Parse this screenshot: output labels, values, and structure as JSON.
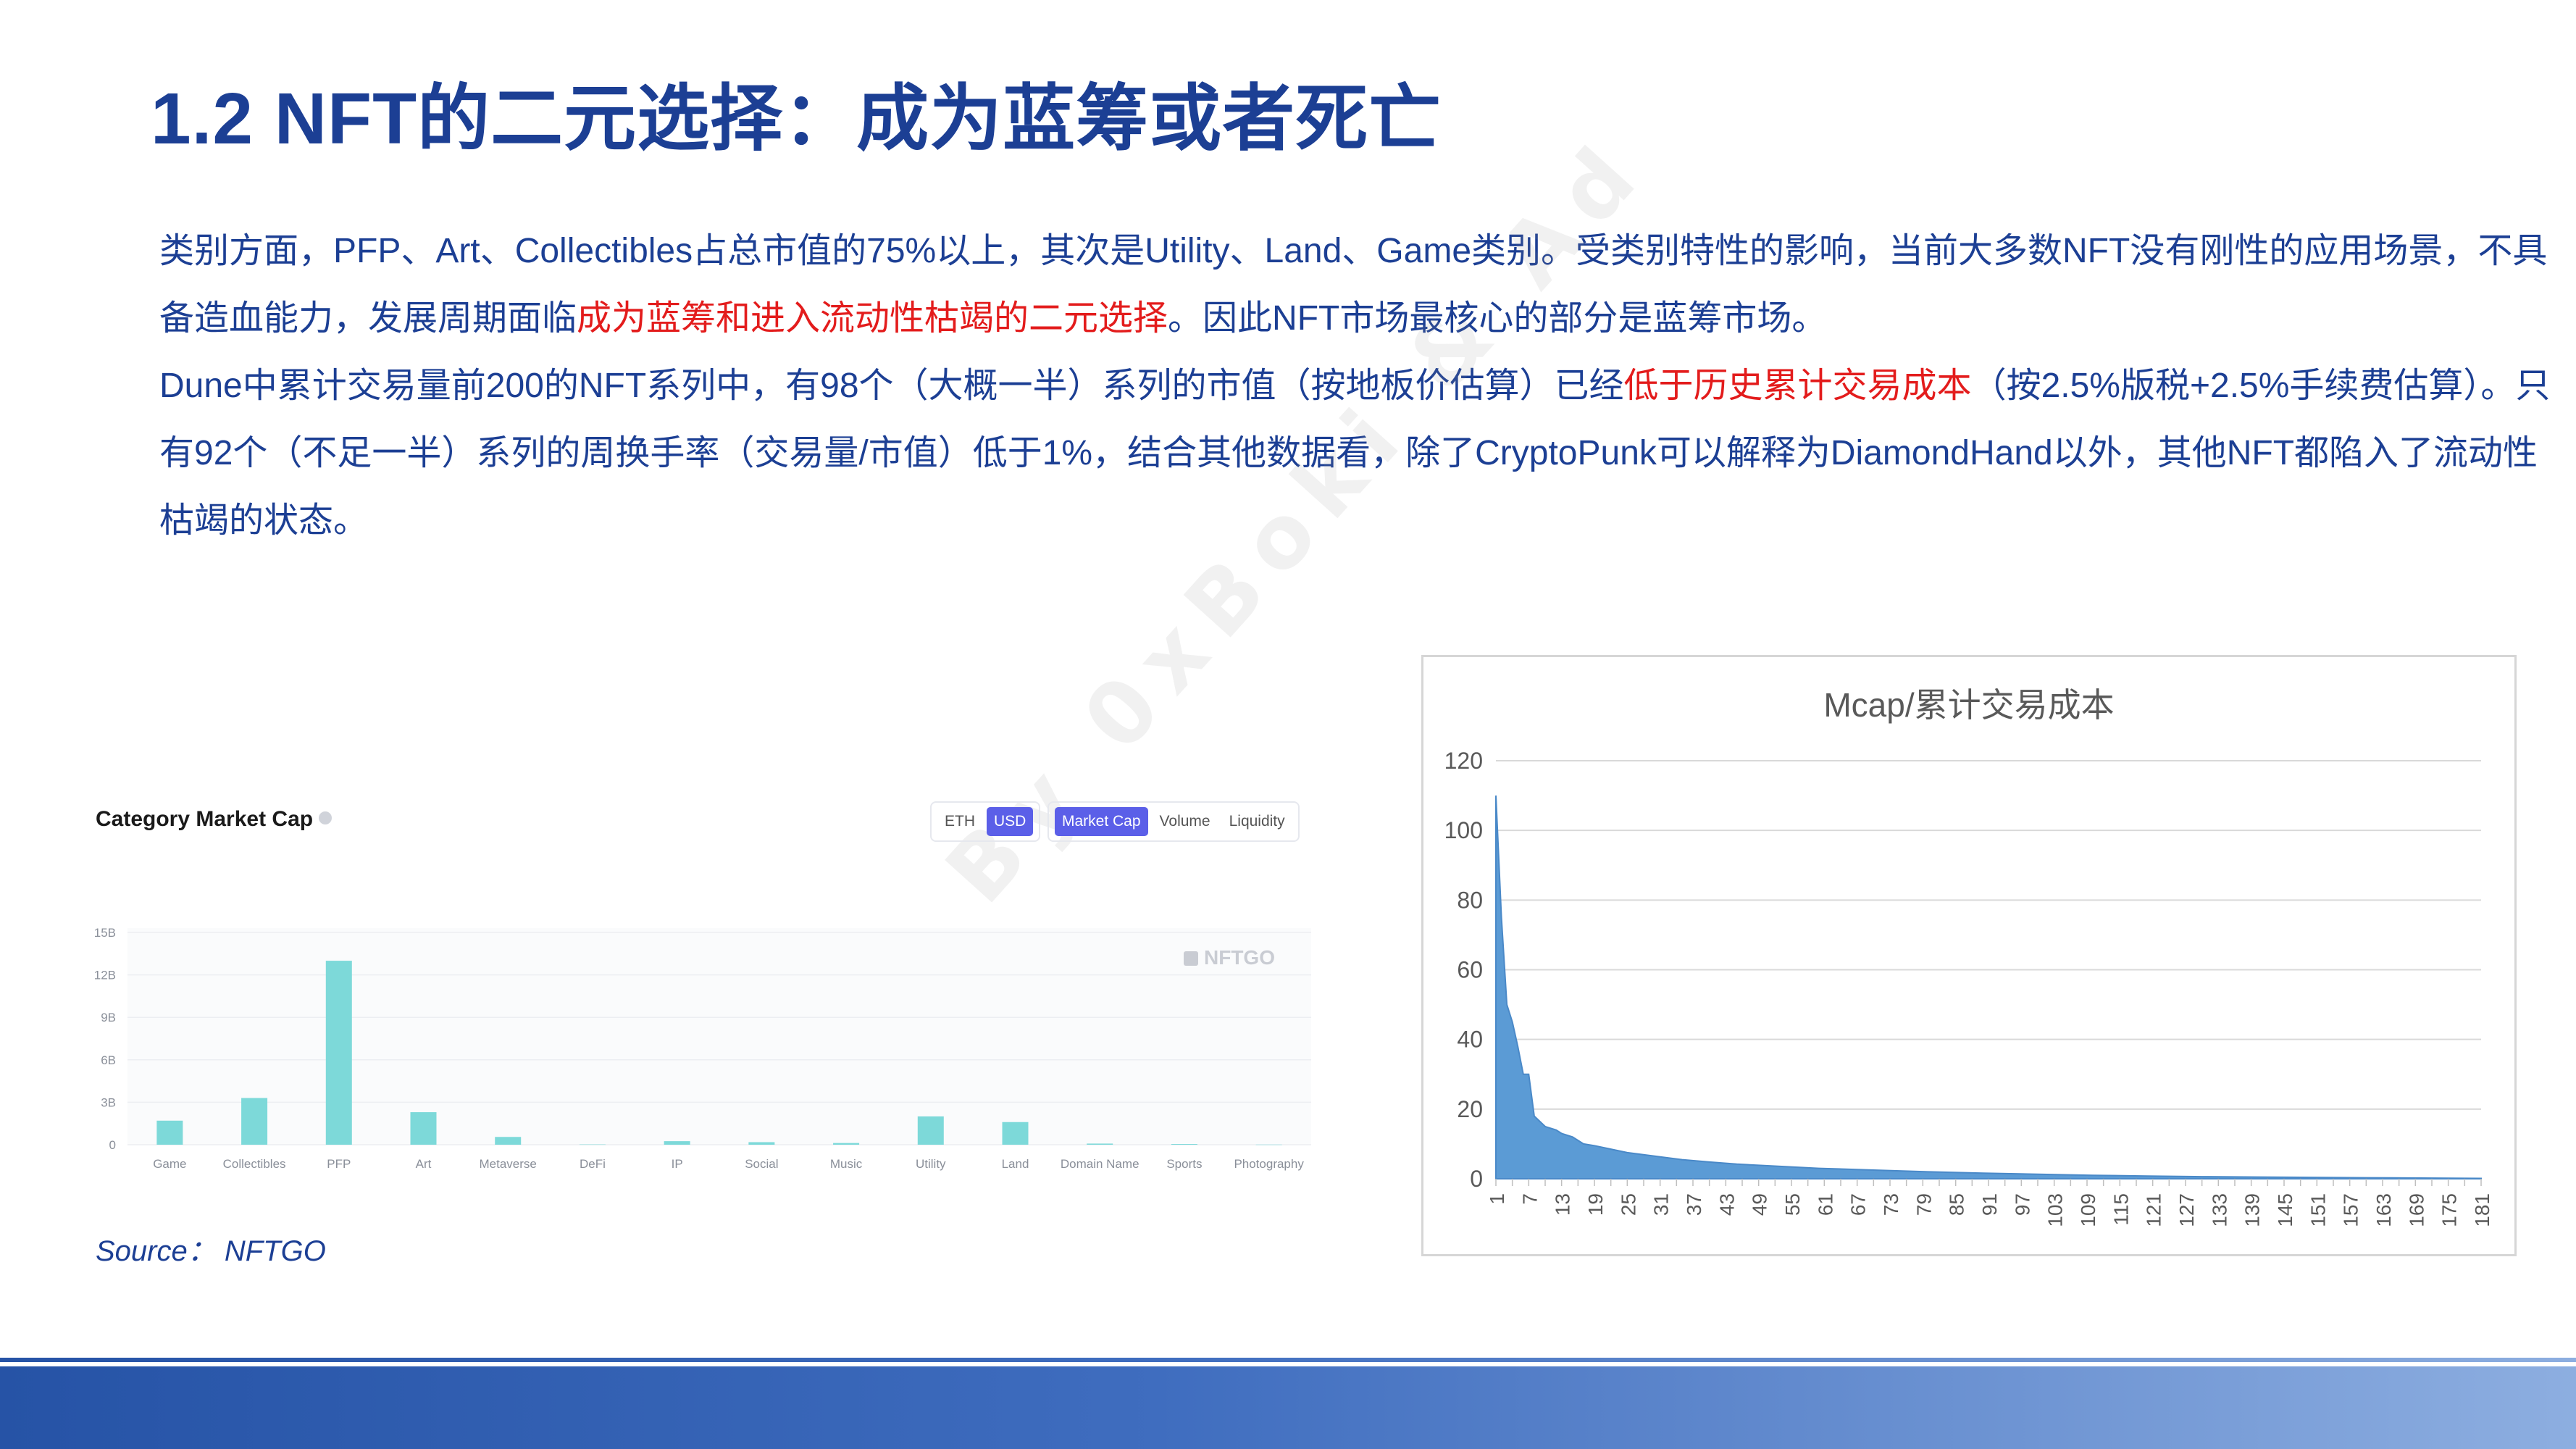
{
  "slide": {
    "title": "1.2 NFT的二元选择：成为蓝筹或者死亡",
    "p1_a": "类别方面，PFP、Art、Collectibles占总市值的75%以上，其次是Utility、Land、Game类别。受类别特性的影响，当前大多数NFT没有刚性的应用场景，不具备造血能力，发展周期面临",
    "p1_hl": "成为蓝筹和进入流动性枯竭的二元选择",
    "p1_b": "。因此NFT市场最核心的部分是蓝筹市场。",
    "p2_a": "Dune中累计交易量前200的NFT系列中，有98个（大概一半）系列的市值（按地板价估算）已经",
    "p2_hl": "低于历史累计交易成本",
    "p2_b": "（按2.5%版税+2.5%手续费估算）。只有92个（不足一半）系列的周换手率（交易量/市值）低于1%，结合其他数据看，除了CryptoPunk可以解释为DiamondHand以外，其他NFT都陷入了流动性枯竭的状态。",
    "watermark": "By 0xBoki & Ad",
    "source": "Source：   NFTGO",
    "colors": {
      "title": "#1c3f94",
      "highlight": "#e31c1c",
      "bar_left": "#7dd9d9",
      "area_right": "#5b9bd5",
      "toggle_active": "#5b5fe8"
    }
  },
  "left_panel": {
    "title": "Category Market Cap",
    "info_icon": "info-icon",
    "currency_toggle": [
      "ETH",
      "USD"
    ],
    "currency_selected": "USD",
    "metric_toggle": [
      "Market Cap",
      "Volume",
      "Liquidity"
    ],
    "metric_selected": "Market Cap",
    "logo_text": "NFTGO"
  },
  "chart_data": [
    {
      "type": "bar",
      "title": "Category Market Cap",
      "categories": [
        "Game",
        "Collectibles",
        "PFP",
        "Art",
        "Metaverse",
        "DeFi",
        "IP",
        "Social",
        "Music",
        "Utility",
        "Land",
        "Domain Name",
        "Sports",
        "Photography"
      ],
      "values": [
        1.7,
        3.3,
        13.0,
        2.3,
        0.55,
        0.02,
        0.25,
        0.18,
        0.12,
        2.0,
        1.6,
        0.08,
        0.05,
        0.01
      ],
      "unit": "B",
      "ytick_labels": [
        "0",
        "3B",
        "6B",
        "9B",
        "12B",
        "15B"
      ],
      "yticks": [
        0,
        3,
        6,
        9,
        12,
        15
      ],
      "ylim": [
        0,
        15
      ],
      "grid": true
    },
    {
      "type": "area",
      "title": "Mcap/累计交易成本",
      "x": [
        1,
        2,
        3,
        4,
        5,
        6,
        7,
        8,
        10,
        12,
        13,
        15,
        17,
        19,
        22,
        25,
        30,
        35,
        40,
        45,
        50,
        60,
        70,
        80,
        90,
        100,
        110,
        120,
        130,
        140,
        150,
        160,
        170,
        181
      ],
      "y": [
        110,
        75,
        50,
        45,
        38,
        30,
        30,
        18,
        15,
        14,
        13,
        12,
        10,
        9.5,
        8.5,
        7.5,
        6.5,
        5.5,
        4.8,
        4.2,
        3.8,
        3.0,
        2.5,
        2.0,
        1.6,
        1.3,
        1.0,
        0.8,
        0.6,
        0.5,
        0.4,
        0.3,
        0.2,
        0.1
      ],
      "xticks": [
        1,
        7,
        13,
        19,
        25,
        31,
        37,
        43,
        49,
        55,
        61,
        67,
        73,
        79,
        85,
        91,
        97,
        103,
        109,
        115,
        121,
        127,
        133,
        139,
        145,
        151,
        157,
        163,
        169,
        175,
        181
      ],
      "yticks": [
        0,
        20,
        40,
        60,
        80,
        100,
        120
      ],
      "xlim": [
        1,
        181
      ],
      "ylim": [
        0,
        120
      ],
      "grid": true
    }
  ]
}
